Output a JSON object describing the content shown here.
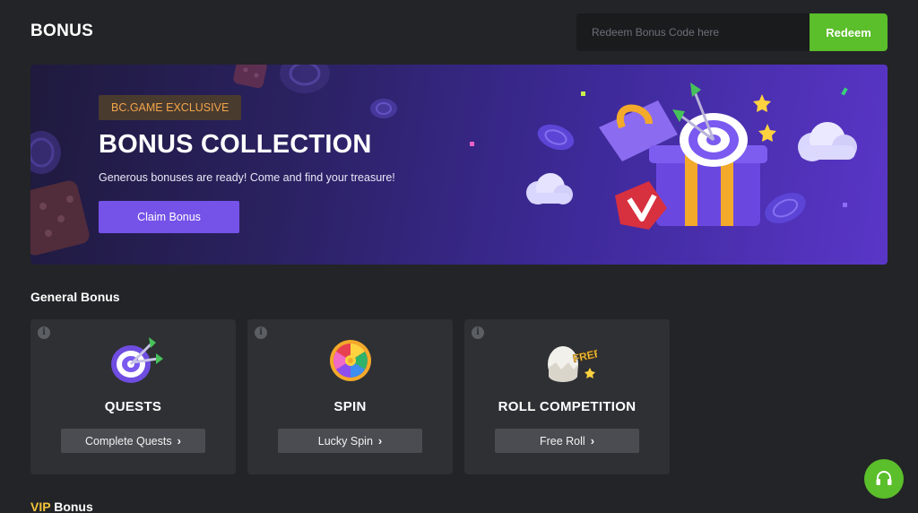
{
  "header": {
    "title": "BONUS",
    "redeem_placeholder": "Redeem Bonus Code here",
    "redeem_label": "Redeem"
  },
  "banner": {
    "tag": "BC.GAME EXCLUSIVE",
    "title": "BONUS COLLECTION",
    "subtitle": "Generous bonuses are ready! Come and find your treasure!",
    "cta_label": "Claim Bonus"
  },
  "general_bonus": {
    "title": "General Bonus",
    "cards": [
      {
        "title": "QUESTS",
        "button_label": "Complete Quests",
        "icon": "target-icon"
      },
      {
        "title": "SPIN",
        "button_label": "Lucky Spin",
        "icon": "spin-wheel-icon"
      },
      {
        "title": "ROLL COMPETITION",
        "button_label": "Free Roll",
        "icon": "free-egg-icon",
        "icon_text": "FREE"
      }
    ]
  },
  "vip_bonus": {
    "title_accent": "VIP",
    "title_rest": " Bonus"
  },
  "support": {
    "icon": "headset-icon"
  },
  "colors": {
    "background": "#232427",
    "card": "#2e3034",
    "accent_green": "#5bbe2b",
    "accent_purple": "#7552e8",
    "vip_gold": "#f3c33b",
    "tag_orange": "#f1a54a"
  }
}
